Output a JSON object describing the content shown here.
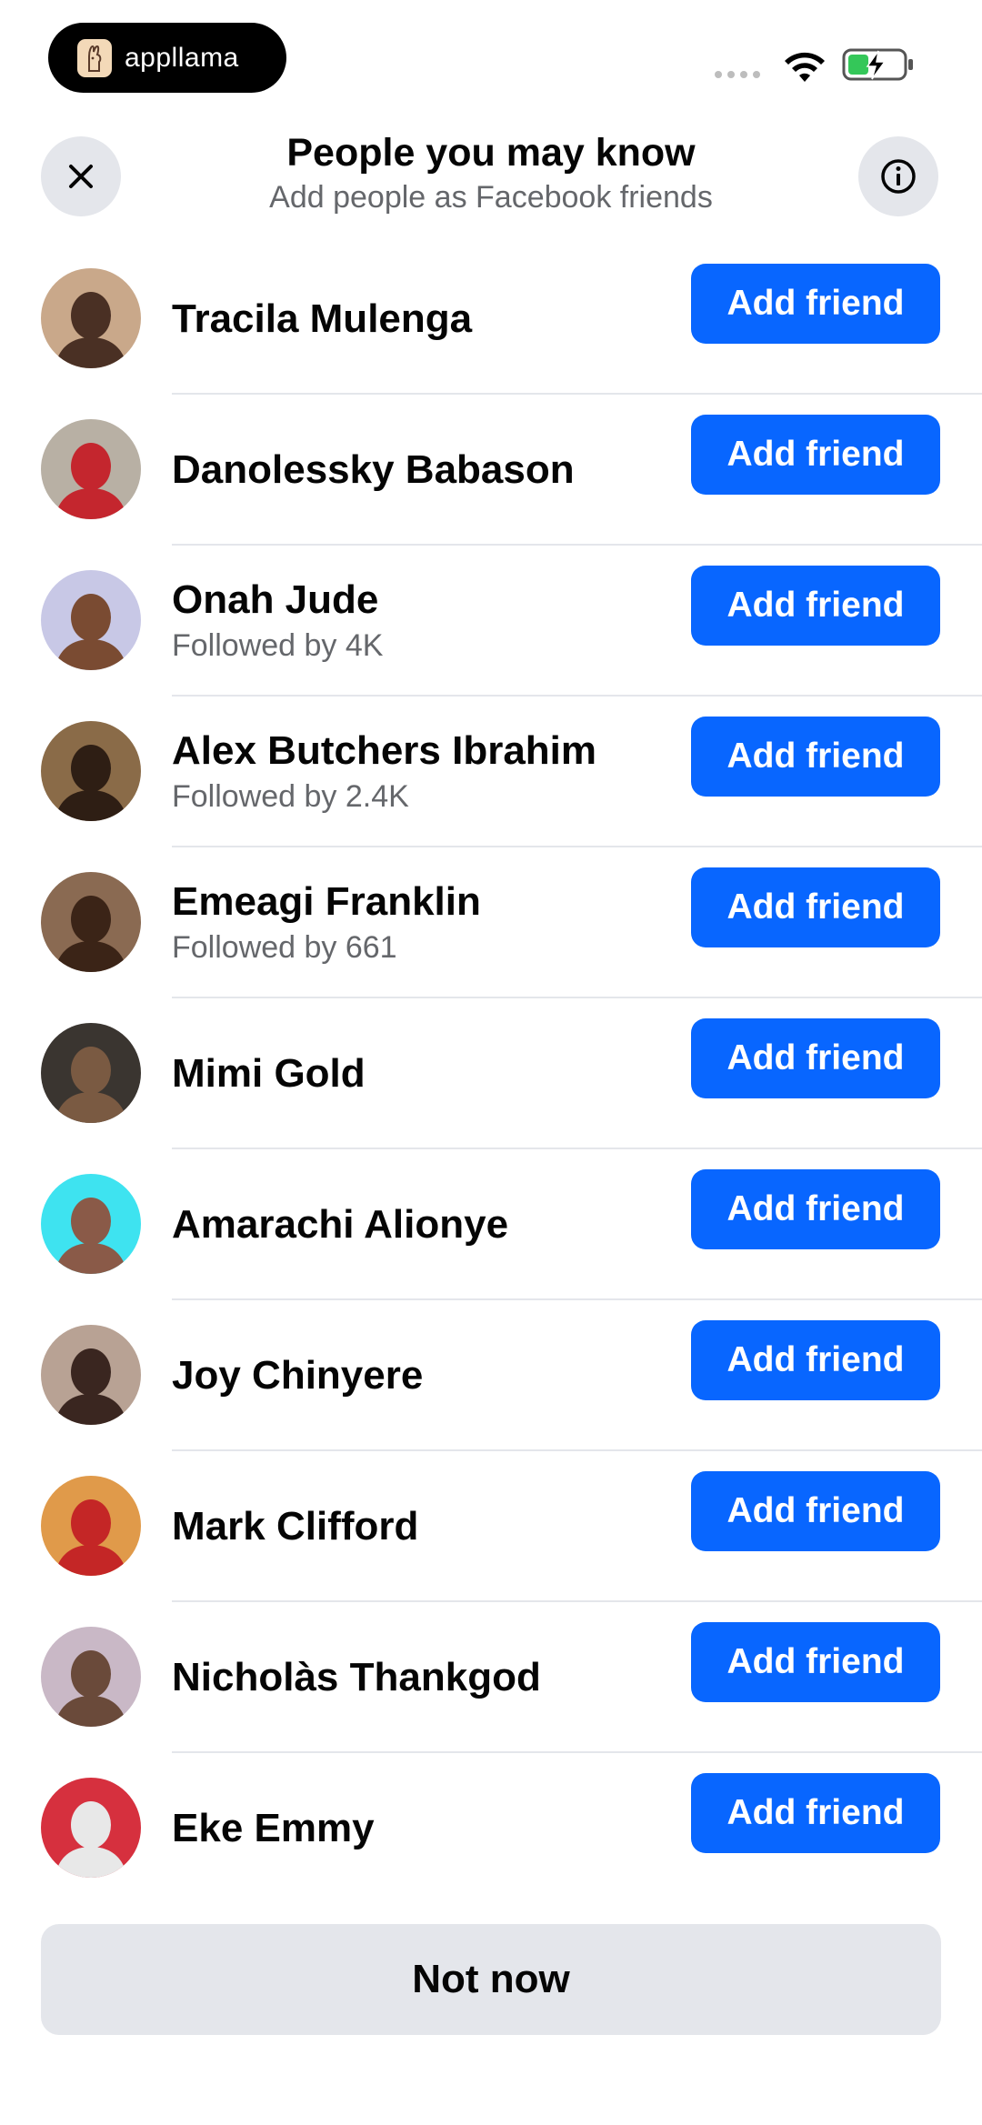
{
  "status_bar": {
    "app_name": "appllama",
    "icons": [
      "appllama-logo-icon",
      "signal-icon",
      "wifi-icon",
      "battery-charging-icon"
    ],
    "battery_color": "#34c759"
  },
  "header": {
    "title": "People you may know",
    "subtitle": "Add people as Facebook friends",
    "close_icon": "close-icon",
    "info_icon": "info-icon"
  },
  "accent_color": "#0866ff",
  "people": [
    {
      "name": "Tracila Mulenga",
      "subtitle": "",
      "button": "Add friend",
      "avatar_colors": [
        "#c9a88a",
        "#4a3024"
      ]
    },
    {
      "name": "Danolessky Babason",
      "subtitle": "",
      "button": "Add friend",
      "avatar_colors": [
        "#b8b0a4",
        "#c4262e"
      ]
    },
    {
      "name": "Onah Jude",
      "subtitle": "Followed by 4K",
      "button": "Add friend",
      "avatar_colors": [
        "#c8c8e6",
        "#7a4b32"
      ]
    },
    {
      "name": "Alex Butchers Ibrahim",
      "subtitle": "Followed by 2.4K",
      "button": "Add friend",
      "avatar_colors": [
        "#8a6b48",
        "#2e1e14"
      ]
    },
    {
      "name": "Emeagi Franklin",
      "subtitle": "Followed by 661",
      "button": "Add friend",
      "avatar_colors": [
        "#8a6a52",
        "#3b2417"
      ]
    },
    {
      "name": "Mimi Gold",
      "subtitle": "",
      "button": "Add friend",
      "avatar_colors": [
        "#3a3530",
        "#7a5a42"
      ]
    },
    {
      "name": "Amarachi Alionye",
      "subtitle": "",
      "button": "Add friend",
      "avatar_colors": [
        "#3ee3f0",
        "#8a5a48"
      ]
    },
    {
      "name": "Joy Chinyere",
      "subtitle": "",
      "button": "Add friend",
      "avatar_colors": [
        "#b8a294",
        "#3a2620"
      ]
    },
    {
      "name": "Mark Clifford",
      "subtitle": "",
      "button": "Add friend",
      "avatar_colors": [
        "#e09a4a",
        "#c42626"
      ]
    },
    {
      "name": "Nicholàs Thankgod",
      "subtitle": "",
      "button": "Add friend",
      "avatar_colors": [
        "#c9b8c6",
        "#6a4a3a"
      ]
    },
    {
      "name": "Eke Emmy",
      "subtitle": "",
      "button": "Add friend",
      "avatar_colors": [
        "#d6303e",
        "#e8e8e8"
      ]
    }
  ],
  "footer": {
    "not_now_label": "Not now"
  }
}
